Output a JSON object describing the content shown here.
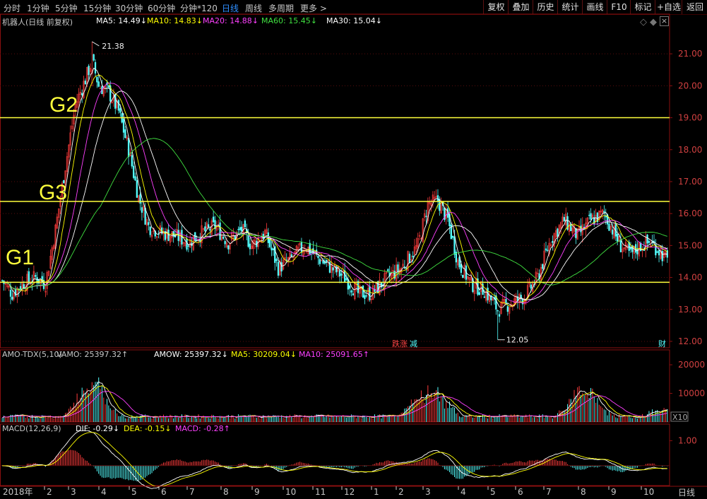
{
  "toolbar": {
    "periods": [
      {
        "label": "分时",
        "active": false
      },
      {
        "label": "1分钟",
        "active": false
      },
      {
        "label": "5分钟",
        "active": false
      },
      {
        "label": "15分钟",
        "active": false
      },
      {
        "label": "30分钟",
        "active": false
      },
      {
        "label": "60分钟",
        "active": false
      },
      {
        "label": "分钟*120",
        "active": false
      },
      {
        "label": "日线",
        "active": true
      },
      {
        "label": "周线",
        "active": false
      },
      {
        "label": "多周期",
        "active": false
      },
      {
        "label": "更多 >",
        "active": false
      }
    ],
    "right_buttons": [
      "复权",
      "叠加",
      "历史",
      "统计",
      "画线",
      "F10",
      "标记",
      "+自选",
      "返回"
    ]
  },
  "title": "机器人(日线 前复权)",
  "ma_legend": [
    {
      "label": "MA5: 14.49",
      "arrow": "↓",
      "color": "#ffffff"
    },
    {
      "label": "MA10: 14.83",
      "arrow": "↓",
      "color": "#ffff00"
    },
    {
      "label": "MA20: 14.88",
      "arrow": "↓",
      "color": "#ff40ff"
    },
    {
      "label": "MA60: 15.45",
      "arrow": "↓",
      "color": "#40e040"
    },
    {
      "label": "MA30: 15.04",
      "arrow": "↓",
      "color": "#ffffff"
    }
  ],
  "controls": {
    "diamond": "◇",
    "diamond_filled": "◆",
    "close": "×"
  },
  "levels": [
    {
      "name": "G2",
      "price": 19.0
    },
    {
      "name": "G3",
      "price": 16.38
    },
    {
      "name": "G1",
      "price": 13.85
    }
  ],
  "annotations": {
    "high": "21.38",
    "low": "12.05",
    "event1": "跌",
    "event2": "涨",
    "event3": "减",
    "fin": "财"
  },
  "volume": {
    "header": [
      {
        "label": "AMO-TDX(5,10)",
        "color": "#c8c8c8"
      },
      {
        "label": "VAMO: 25397.32",
        "color": "#c8c8c8",
        "arrow": "↑"
      },
      {
        "label": "AMOW: 25397.32",
        "color": "#ffffff",
        "arrow": "↓"
      },
      {
        "label": "MA5: 30209.04",
        "color": "#ffff00",
        "arrow": "↓"
      },
      {
        "label": "MA10: 25091.65",
        "color": "#ff40ff",
        "arrow": "↑"
      }
    ],
    "ticks": [
      "20000",
      "10000"
    ],
    "unit": "X10"
  },
  "macd": {
    "header": [
      {
        "label": "MACD(12,26,9)",
        "color": "#c8c8c8"
      },
      {
        "label": "DIF: -0.29",
        "color": "#ffffff",
        "arrow": "↓"
      },
      {
        "label": "DEA: -0.15",
        "color": "#ffff00",
        "arrow": "↓"
      },
      {
        "label": "MACD: -0.28",
        "color": "#ff40ff",
        "arrow": "↑"
      }
    ],
    "ticks": [
      "1.00"
    ]
  },
  "x_axis": [
    "2018年",
    "2",
    "3",
    "4",
    "5",
    "6",
    "7",
    "8",
    "9",
    "10",
    "11",
    "12",
    "1",
    "2",
    "3",
    "4",
    "5",
    "6",
    "7",
    "8",
    "9",
    "10"
  ],
  "bottom_right": "日线",
  "chart_data": {
    "type": "candlestick",
    "price_ticks": [
      21.0,
      20.0,
      19.0,
      18.0,
      17.0,
      16.0,
      15.0,
      14.0,
      13.0,
      12.0
    ],
    "ylim": [
      11.8,
      21.8
    ],
    "closes_keypoints": [
      [
        0,
        13.9
      ],
      [
        6,
        13.5
      ],
      [
        12,
        13.8
      ],
      [
        20,
        14.0
      ],
      [
        26,
        13.8
      ],
      [
        32,
        15.5
      ],
      [
        38,
        17.5
      ],
      [
        44,
        19.4
      ],
      [
        50,
        20.2
      ],
      [
        54,
        20.8
      ],
      [
        58,
        20.0
      ],
      [
        64,
        19.8
      ],
      [
        70,
        19.2
      ],
      [
        76,
        18.0
      ],
      [
        82,
        16.5
      ],
      [
        88,
        15.6
      ],
      [
        96,
        15.4
      ],
      [
        104,
        15.3
      ],
      [
        112,
        15.1
      ],
      [
        120,
        15.4
      ],
      [
        128,
        15.6
      ],
      [
        136,
        15.1
      ],
      [
        144,
        15.5
      ],
      [
        150,
        15.0
      ],
      [
        158,
        15.4
      ],
      [
        166,
        14.3
      ],
      [
        174,
        14.6
      ],
      [
        182,
        15.0
      ],
      [
        190,
        14.6
      ],
      [
        198,
        14.3
      ],
      [
        206,
        14.0
      ],
      [
        214,
        13.5
      ],
      [
        222,
        13.5
      ],
      [
        232,
        14.0
      ],
      [
        240,
        14.3
      ],
      [
        250,
        15.0
      ],
      [
        256,
        16.3
      ],
      [
        262,
        16.4
      ],
      [
        268,
        15.8
      ],
      [
        274,
        14.5
      ],
      [
        282,
        13.8
      ],
      [
        290,
        13.6
      ],
      [
        298,
        13.0
      ],
      [
        306,
        13.2
      ],
      [
        314,
        13.4
      ],
      [
        322,
        14.0
      ],
      [
        330,
        15.2
      ],
      [
        338,
        15.8
      ],
      [
        346,
        15.3
      ],
      [
        354,
        15.8
      ],
      [
        362,
        16.0
      ],
      [
        366,
        15.6
      ],
      [
        372,
        15.0
      ],
      [
        378,
        14.7
      ],
      [
        384,
        15.0
      ],
      [
        390,
        15.1
      ],
      [
        396,
        14.8
      ],
      [
        400,
        14.5
      ]
    ],
    "volume_peaks": [
      [
        50,
        11000
      ],
      [
        58,
        9800
      ],
      [
        250,
        8500
      ],
      [
        262,
        10500
      ],
      [
        346,
        9500
      ],
      [
        354,
        8000
      ],
      [
        398,
        4500
      ]
    ],
    "volume_ylim": [
      0,
      22000
    ],
    "macd_ylim": [
      -0.8,
      1.3
    ]
  }
}
